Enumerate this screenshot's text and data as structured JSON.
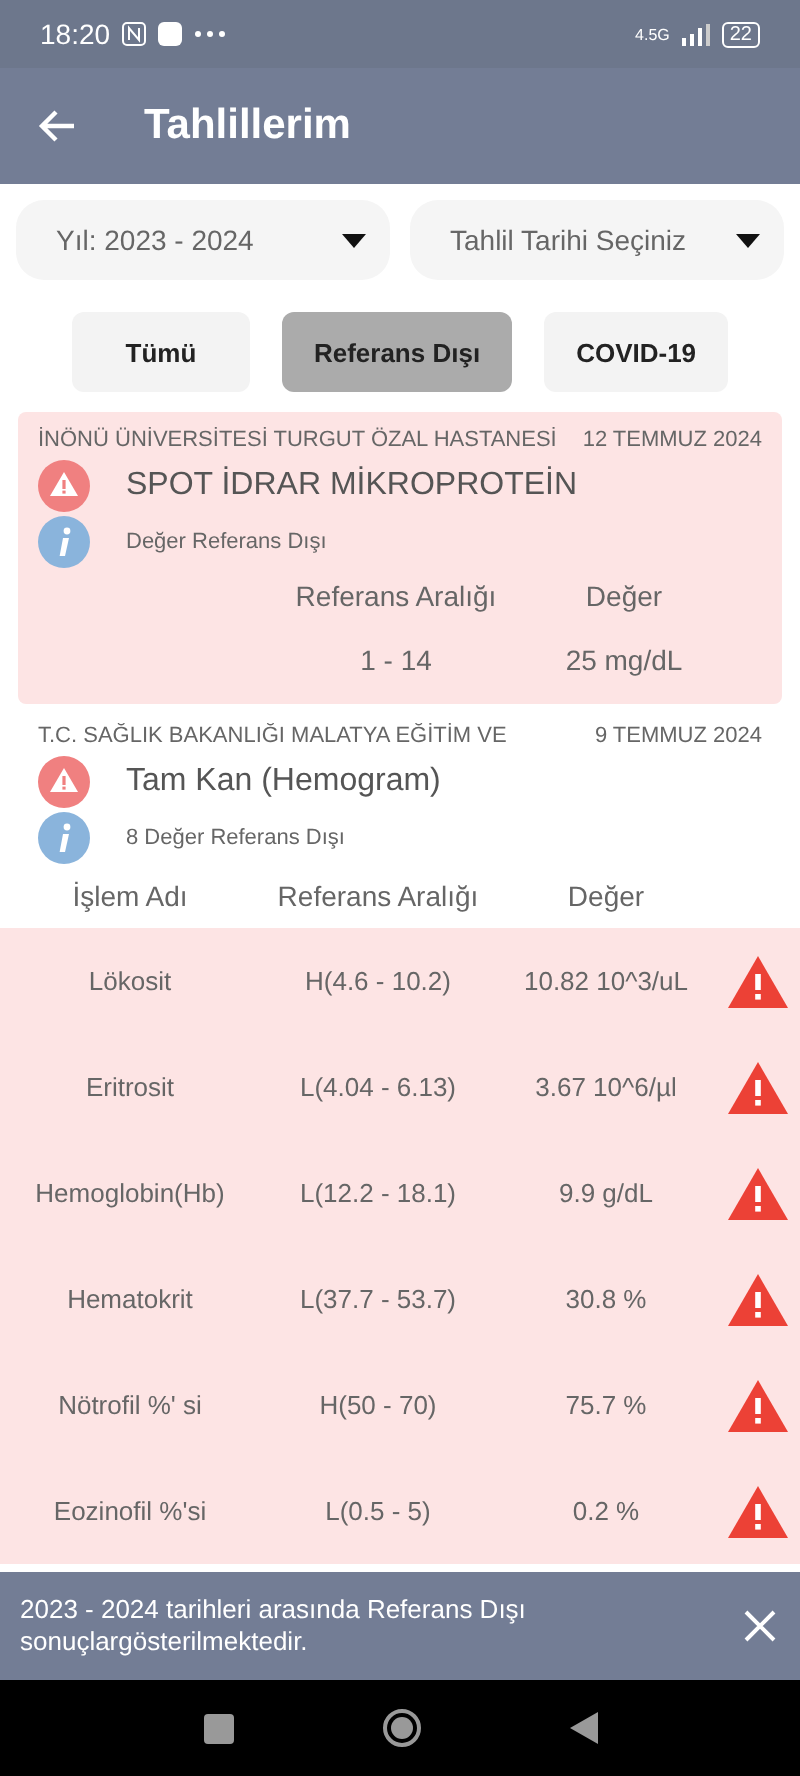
{
  "status_bar": {
    "time": "18:20",
    "network": "4.5G",
    "battery": "22"
  },
  "app_bar": {
    "title": "Tahlillerim"
  },
  "dropdowns": [
    {
      "value": "Yıl: 2023 - 2024"
    },
    {
      "value": "Tahlil Tarihi Seçiniz"
    }
  ],
  "filters": [
    {
      "label": "Tümü",
      "selected": false
    },
    {
      "label": "Referans Dışı",
      "selected": true
    },
    {
      "label": "COVID-19",
      "selected": false
    }
  ],
  "results": [
    {
      "hospital": "İNÖNÜ ÜNİVERSİTESİ TURGUT ÖZAL  HASTANESİ",
      "date": "12 TEMMUZ 2024",
      "test": "SPOT İDRAR MİKROPROTEİN",
      "note": "Değer Referans Dışı",
      "highlighted": true,
      "columns": [
        "Referans Aralığı",
        "Değer"
      ],
      "rows": [
        {
          "cells": [
            "1 - 14",
            "25 mg/dL"
          ],
          "abnormal": false
        }
      ]
    },
    {
      "hospital": "T.C. SAĞLIK BAKANLIĞI MALATYA EĞİTİM VE",
      "date": "9 TEMMUZ 2024",
      "test": "Tam Kan (Hemogram)",
      "note": "8 Değer Referans Dışı",
      "highlighted": false,
      "columns": [
        "İşlem Adı",
        "Referans Aralığı",
        "Değer"
      ],
      "rows": [
        {
          "cells": [
            "Lökosit",
            "H(4.6 - 10.2)",
            "10.82 10^3/uL"
          ],
          "abnormal": true
        },
        {
          "cells": [
            "Eritrosit",
            "L(4.04 - 6.13)",
            "3.67 10^6/µl"
          ],
          "abnormal": true
        },
        {
          "cells": [
            "Hemoglobin(Hb)",
            "L(12.2 - 18.1)",
            "9.9 g/dL"
          ],
          "abnormal": true
        },
        {
          "cells": [
            "Hematokrit",
            "L(37.7 - 53.7)",
            "30.8 %"
          ],
          "abnormal": true
        },
        {
          "cells": [
            "Nötrofil %' si",
            "H(50 - 70)",
            "75.7 %"
          ],
          "abnormal": true
        },
        {
          "cells": [
            "Eozinofil %'si",
            "L(0.5 - 5)",
            "0.2 %"
          ],
          "abnormal": true
        }
      ]
    }
  ],
  "snackbar": {
    "message": "2023 - 2024 tarihleri arasında Referans Dışı sonuçlargösterilmektedir."
  }
}
